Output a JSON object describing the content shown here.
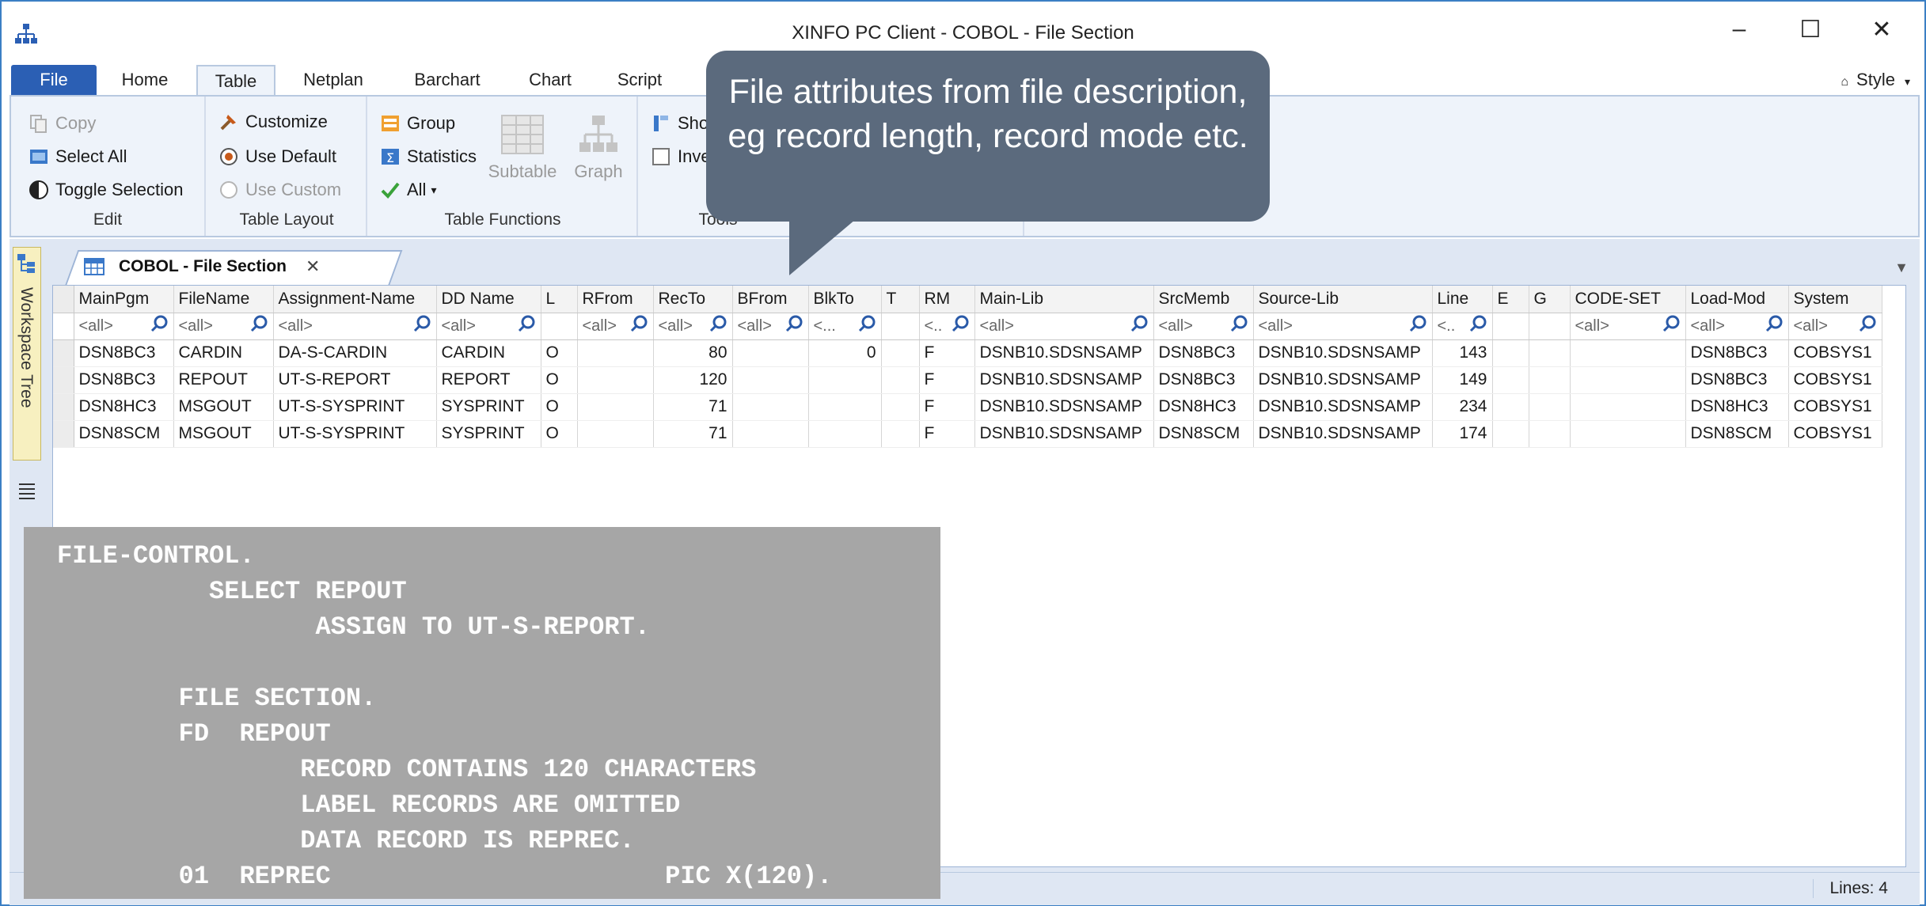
{
  "window": {
    "title": "XINFO PC Client - COBOL - File Section",
    "controls": {
      "minimize": "–",
      "maximize": "☐",
      "close": "✕"
    }
  },
  "ribbon_tabs": [
    "File",
    "Home",
    "Table",
    "Netplan",
    "Barchart",
    "Chart",
    "Script"
  ],
  "style_label": "Style",
  "ribbon": {
    "edit": {
      "label": "Edit",
      "copy": "Copy",
      "select_all": "Select All",
      "toggle_selection": "Toggle Selection"
    },
    "table_layout": {
      "label": "Table Layout",
      "customize": "Customize",
      "use_default": "Use Default",
      "use_custom": "Use Custom"
    },
    "table_functions": {
      "label": "Table Functions",
      "group": "Group",
      "statistics": "Statistics",
      "all": "All",
      "subtable": "Subtable",
      "graph": "Graph"
    },
    "tools": {
      "label": "Tools",
      "show": "Sho",
      "invert": "Inve"
    }
  },
  "callout": {
    "text": "File attributes from file description, eg record length, record mode etc."
  },
  "workspace": {
    "sidebar_label": "Workspace Tree",
    "doc_tab": "COBOL - File Section",
    "doc_tab_close": "✕"
  },
  "grid": {
    "columns": [
      "MainPgm",
      "FileName",
      "Assignment-Name",
      "DD Name",
      "L",
      "RFrom",
      "RecTo",
      "BFrom",
      "BlkTo",
      "T",
      "RM",
      "Main-Lib",
      "SrcMemb",
      "Source-Lib",
      "Line",
      "E",
      "G",
      "CODE-SET",
      "Load-Mod",
      "System"
    ],
    "filters": [
      "<all>",
      "<all>",
      "<all>",
      "<all>",
      "",
      "<all>",
      "<all>",
      "<all>",
      "<...",
      "",
      "<..",
      "<all>",
      "<all>",
      "<all>",
      "<..",
      "",
      "",
      "<all>",
      "<all>",
      "<all>"
    ],
    "rows": [
      [
        "DSN8BC3",
        "CARDIN",
        "DA-S-CARDIN",
        "CARDIN",
        "O",
        "",
        "80",
        "",
        "0",
        "",
        "F",
        "DSNB10.SDSNSAMP",
        "DSN8BC3",
        "DSNB10.SDSNSAMP",
        "143",
        "",
        "",
        "",
        "DSN8BC3",
        "COBSYS1"
      ],
      [
        "DSN8BC3",
        "REPOUT",
        "UT-S-REPORT",
        "REPORT",
        "O",
        "",
        "120",
        "",
        "",
        "",
        "F",
        "DSNB10.SDSNSAMP",
        "DSN8BC3",
        "DSNB10.SDSNSAMP",
        "149",
        "",
        "",
        "",
        "DSN8BC3",
        "COBSYS1"
      ],
      [
        "DSN8HC3",
        "MSGOUT",
        "UT-S-SYSPRINT",
        "SYSPRINT",
        "O",
        "",
        "71",
        "",
        "",
        "",
        "F",
        "DSNB10.SDSNSAMP",
        "DSN8HC3",
        "DSNB10.SDSNSAMP",
        "234",
        "",
        "",
        "",
        "DSN8HC3",
        "COBSYS1"
      ],
      [
        "DSN8SCM",
        "MSGOUT",
        "UT-S-SYSPRINT",
        "SYSPRINT",
        "O",
        "",
        "71",
        "",
        "",
        "",
        "F",
        "DSNB10.SDSNSAMP",
        "DSN8SCM",
        "DSNB10.SDSNSAMP",
        "174",
        "",
        "",
        "",
        "DSN8SCM",
        "COBSYS1"
      ]
    ]
  },
  "status": {
    "lines": "Lines: 4"
  },
  "cobol_code": "FILE-CONTROL.\n          SELECT REPOUT\n                 ASSIGN TO UT-S-REPORT.\n\n        FILE SECTION.\n        FD  REPOUT\n                RECORD CONTAINS 120 CHARACTERS\n                LABEL RECORDS ARE OMITTED\n                DATA RECORD IS REPREC.\n        01  REPREC                      PIC X(120).",
  "colors": {
    "accent": "#2b5fb4",
    "callout": "#5b6a7d",
    "overlay": "#a6a6a6",
    "ribbon_bg": "#eef3fa"
  }
}
